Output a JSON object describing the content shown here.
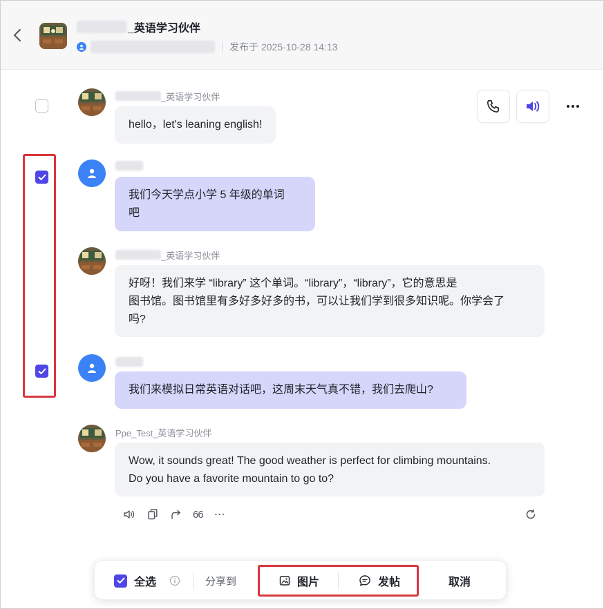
{
  "header": {
    "title_suffix": "_英语学习伙伴",
    "published_prefix": "发布于",
    "published_time": "2025-10-28 14:13"
  },
  "actions": {
    "icons": [
      "phone-icon",
      "speaker-icon",
      "more-icon"
    ]
  },
  "messages": [
    {
      "role": "bot",
      "sender_suffix": "_英语学习伙伴",
      "text": "hello，let's leaning english!",
      "selected": false
    },
    {
      "role": "user",
      "sender_suffix": "",
      "text_lines": [
        "我们今天学点小学 5 年级的单词",
        "吧"
      ],
      "selected": true
    },
    {
      "role": "bot",
      "sender_suffix": "_英语学习伙伴",
      "text_lines": [
        "好呀！我们来学 “library” 这个单词。“library”，“library”，它的意思是",
        "图书馆。图书馆里有多好多好多的书，可以让我们学到很多知识呢。你学会了",
        "吗?"
      ],
      "selected": false
    },
    {
      "role": "user",
      "sender_suffix": "",
      "text": "我们来模拟日常英语对话吧，这周末天气真不错，我们去爬山?",
      "selected": true
    },
    {
      "role": "bot",
      "sender": "Ppe_Test_英语学习伙伴",
      "text_lines": [
        "Wow, it sounds great! The good weather is perfect for climbing mountains.",
        "Do you have a favorite mountain to go to?"
      ],
      "selected": false
    }
  ],
  "message_tools": {
    "quote_label": "66",
    "more_label": "⋯"
  },
  "bottom_bar": {
    "select_all_label": "全选",
    "share_to_label": "分享到",
    "image_label": "图片",
    "post_label": "发帖",
    "cancel_label": "取消"
  },
  "colors": {
    "accent": "#4f46e5",
    "user_bubble": "#d6d6fb",
    "bot_bubble": "#f2f3f5",
    "highlight_box": "#d9363e",
    "user_avatar": "#3b82f6"
  }
}
